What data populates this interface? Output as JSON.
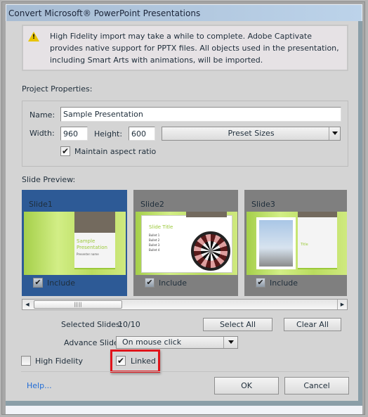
{
  "window": {
    "title": "Convert Microsoft® PowerPoint Presentations"
  },
  "warning": {
    "icon": "warning-icon",
    "text": "High Fidelity import may take a while to complete. Adobe Captivate provides native support for PPTX files. All objects used in the presentation, including Smart Arts with animations, will be imported."
  },
  "project": {
    "section_label": "Project Properties:",
    "name_label": "Name:",
    "name_value": "Sample Presentation",
    "width_label": "Width:",
    "width_value": "960",
    "height_label": "Height:",
    "height_value": "600",
    "preset_label": "Preset Sizes",
    "maintain_label": "Maintain aspect ratio",
    "maintain_checked": true
  },
  "preview": {
    "section_label": "Slide Preview:",
    "slides": [
      {
        "name": "Slide1",
        "include_label": "Include",
        "checked": true,
        "selected": true,
        "title": "Sample Presentation",
        "subtitle": "Presenter name"
      },
      {
        "name": "Slide2",
        "include_label": "Include",
        "checked": true,
        "selected": false,
        "title": "Slide Title",
        "bullets": [
          "Bullet 1",
          "Bullet 2",
          "Bullet 3",
          "Bullet 4"
        ]
      },
      {
        "name": "Slide3",
        "include_label": "Include",
        "checked": true,
        "selected": false,
        "title": "Title"
      }
    ]
  },
  "selection": {
    "selected_label": "Selected Slides:",
    "selected_value": "10/10",
    "select_all": "Select All",
    "clear_all": "Clear All"
  },
  "advance": {
    "label": "Advance Slide:",
    "value": "On mouse click"
  },
  "options": {
    "high_fidelity_label": "High Fidelity",
    "high_fidelity_checked": false,
    "linked_label": "Linked",
    "linked_checked": true
  },
  "footer": {
    "help": "Help...",
    "ok": "OK",
    "cancel": "Cancel"
  },
  "colors": {
    "selected_slide": "#2d5a96",
    "slide_bg": "#7f7f7f",
    "highlight": "#e0141a",
    "accent_green": "#9bc93a"
  }
}
